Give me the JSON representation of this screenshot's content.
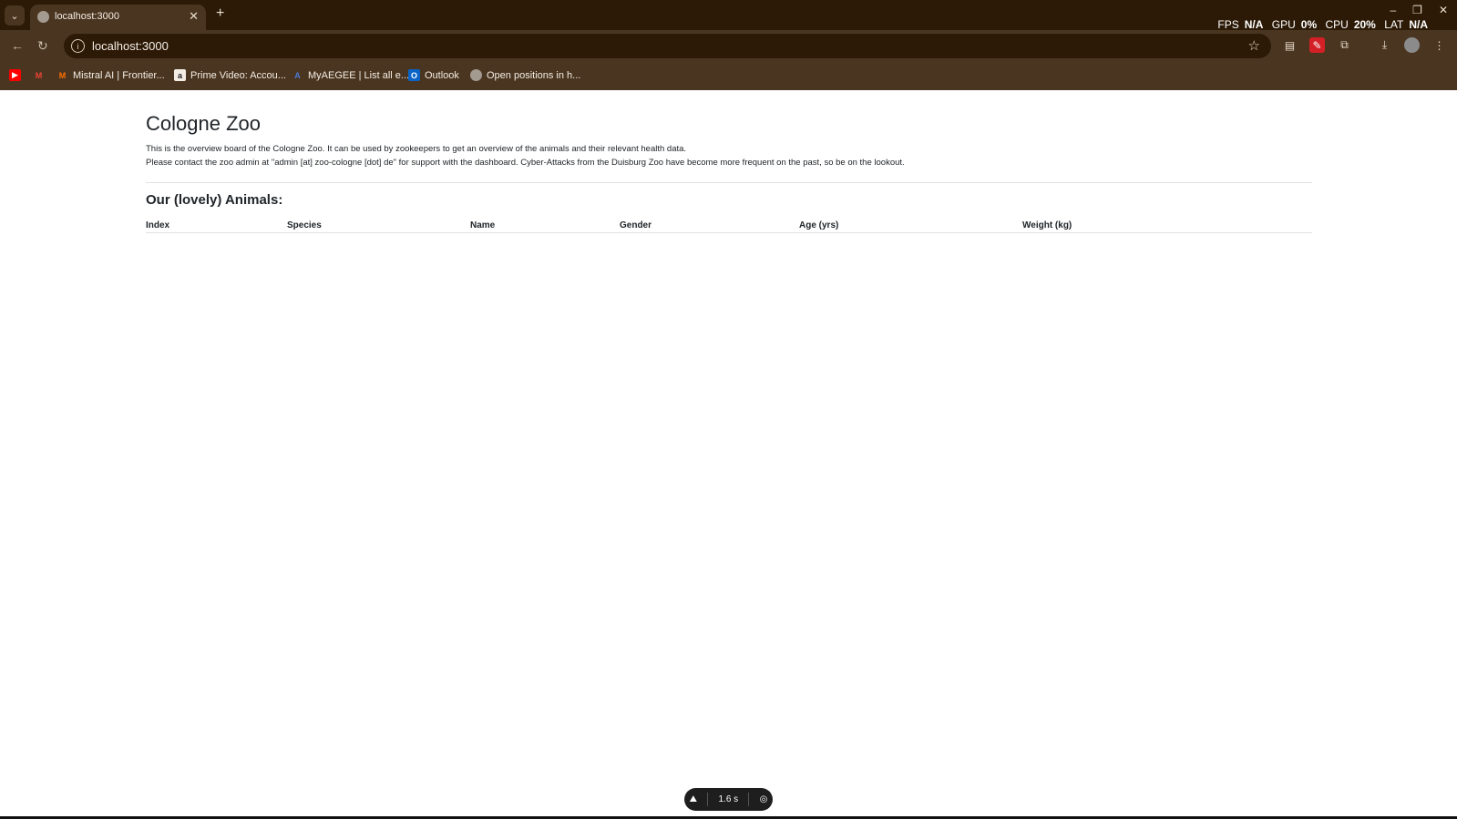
{
  "browser": {
    "tab_title": "localhost:3000",
    "address": "localhost:3000",
    "overlay": {
      "fps_label": "FPS",
      "fps_value": "N/A",
      "gpu_label": "GPU",
      "gpu_value": "0%",
      "cpu_label": "CPU",
      "cpu_value": "20%",
      "lat_label": "LAT",
      "lat_value": "N/A"
    },
    "bookmarks": [
      {
        "label": "Mistral AI | Frontier..."
      },
      {
        "label": "Prime Video: Accou..."
      },
      {
        "label": "MyAEGEE | List all e..."
      },
      {
        "label": "Outlook"
      },
      {
        "label": "Open positions in h..."
      }
    ]
  },
  "page": {
    "title": "Cologne Zoo",
    "intro_line1": "This is the overview board of the Cologne Zoo. It can be used by zookeepers to get an overview of the animals and their relevant health data.",
    "intro_line2": "Please contact the zoo admin at \"admin [at] zoo-cologne [dot] de\" for support with the dashboard. Cyber-Attacks from the Duisburg Zoo have become more frequent on the past, so be on the lookout.",
    "section_heading": "Our (lovely) Animals:",
    "table_headers": [
      "Index",
      "Species",
      "Name",
      "Gender",
      "Age (yrs)",
      "Weight (kg)"
    ]
  },
  "pill": {
    "timer": "1.6 s"
  },
  "colors": {
    "chrome_dark": "#2c1a07",
    "chrome_mid": "#4a3520"
  }
}
